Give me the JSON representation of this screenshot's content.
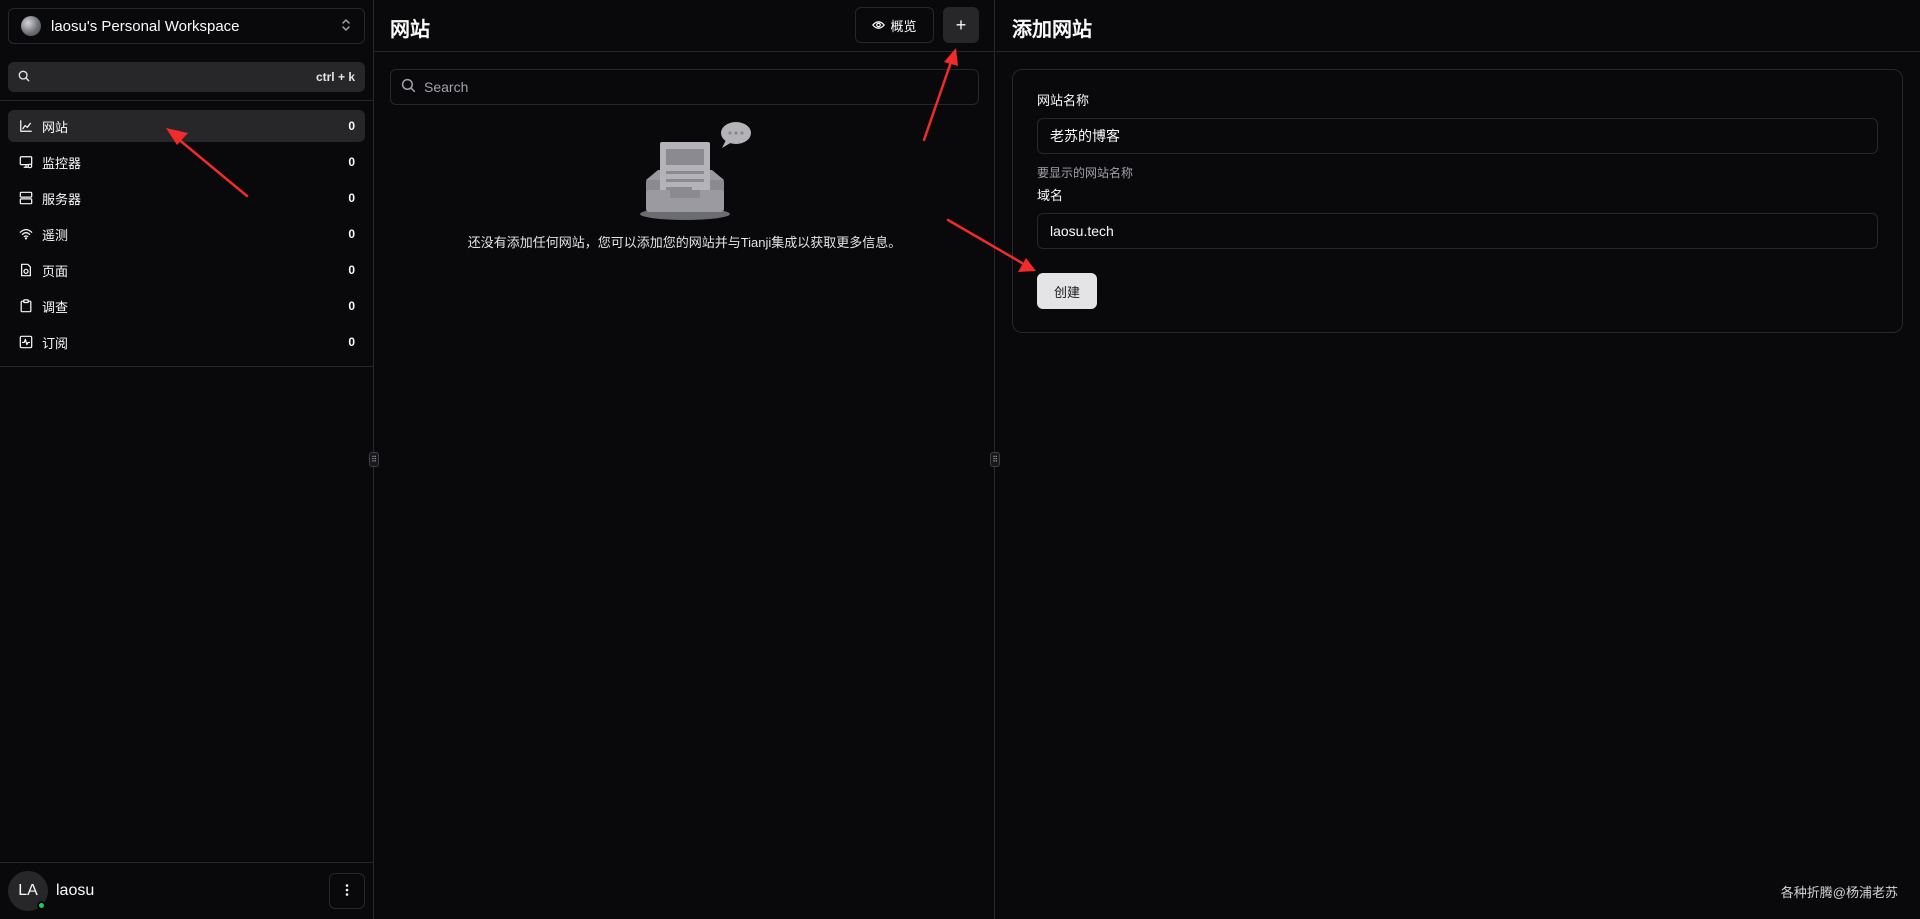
{
  "sidebar": {
    "workspace_name": "laosu's Personal Workspace",
    "search_shortcut": "ctrl + k",
    "nav_items": [
      {
        "label": "网站",
        "count": "0",
        "icon": "chart-line-icon",
        "active": true
      },
      {
        "label": "监控器",
        "count": "0",
        "icon": "monitor-icon",
        "active": false
      },
      {
        "label": "服务器",
        "count": "0",
        "icon": "server-icon",
        "active": false
      },
      {
        "label": "遥测",
        "count": "0",
        "icon": "wifi-icon",
        "active": false
      },
      {
        "label": "页面",
        "count": "0",
        "icon": "file-icon",
        "active": false
      },
      {
        "label": "调查",
        "count": "0",
        "icon": "clipboard-icon",
        "active": false
      },
      {
        "label": "订阅",
        "count": "0",
        "icon": "activity-square-icon",
        "active": false
      }
    ],
    "user": {
      "initials": "LA",
      "name": "laosu",
      "status": "online",
      "status_color": "#22c55e"
    }
  },
  "websites_panel": {
    "title": "网站",
    "overview_label": "概览",
    "add_button_label": "+",
    "search_placeholder": "Search",
    "empty_message": "还没有添加任何网站，您可以添加您的网站并与Tianji集成以获取更多信息。"
  },
  "add_panel": {
    "title": "添加网站",
    "name_label": "网站名称",
    "name_value": "老苏的博客",
    "name_hint": "要显示的网站名称",
    "domain_label": "域名",
    "domain_value": "laosu.tech",
    "create_label": "创建"
  },
  "watermark": "各种折腾@杨浦老苏",
  "colors": {
    "background": "#09090b",
    "border": "#27272a",
    "active_bg": "#27272a",
    "annotation_arrow": "#ef2b2b",
    "primary_button": "#e4e4e7"
  }
}
